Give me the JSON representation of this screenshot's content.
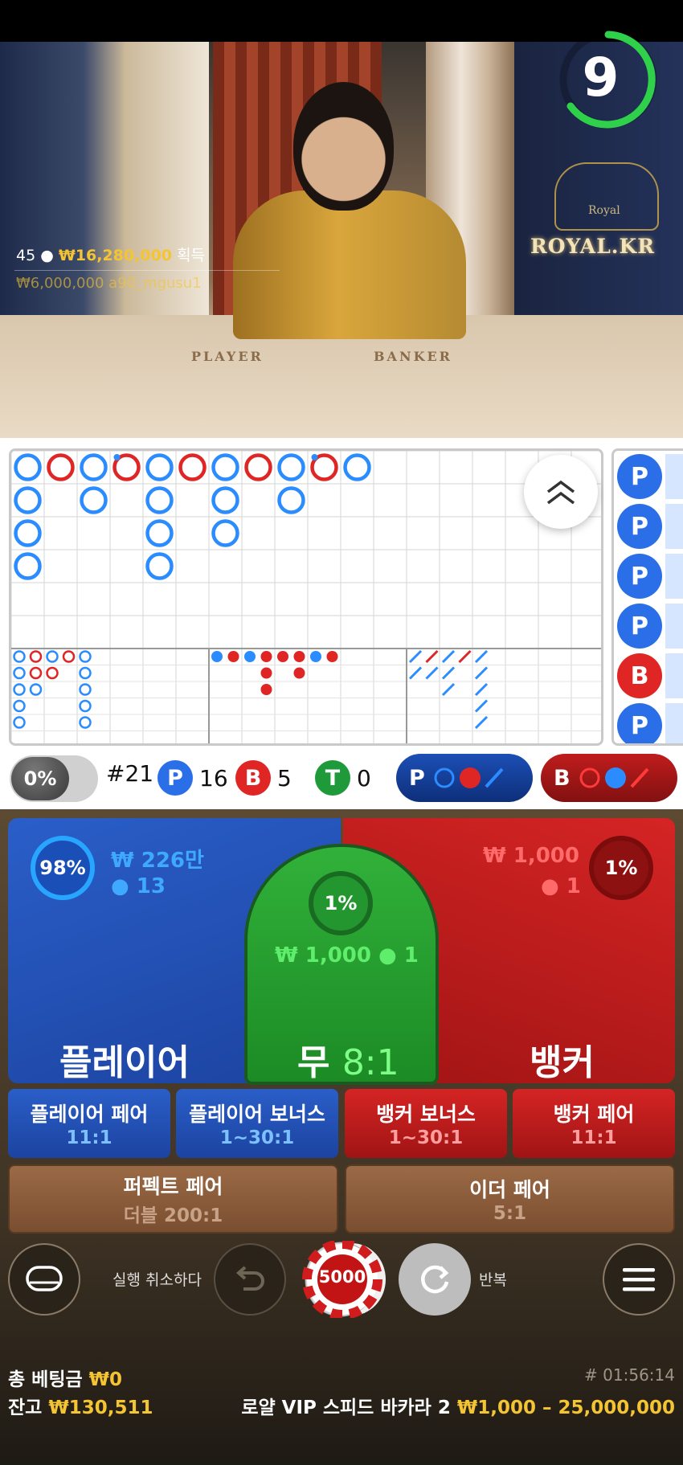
{
  "video": {
    "timer": "9",
    "logo_text": "ROYAL.KR",
    "crest_text": "Royal",
    "table_player": "PLAYER",
    "table_banker": "BANKER",
    "winners_count": "45",
    "winnings_amount": "₩16,280,000",
    "winnings_label": "획득",
    "last_win": "₩6,000,000  a90_mgusu1"
  },
  "stats": {
    "percent_toggle": "0%",
    "round": "#21",
    "player_letter": "P",
    "player_count": "16",
    "banker_letter": "B",
    "banker_count": "5",
    "tie_letter": "T",
    "tie_count": "0",
    "predict_player": "P",
    "predict_banker": "B"
  },
  "side_chips": [
    "P",
    "P",
    "P",
    "P",
    "B",
    "P"
  ],
  "bets": {
    "player": {
      "label": "플레이어",
      "percent": "98%",
      "amount": "₩ 226만",
      "users": "13"
    },
    "tie": {
      "label": "무",
      "odds": "8:1",
      "percent": "1%",
      "amount": "₩ 1,000",
      "users": "1"
    },
    "banker": {
      "label": "뱅커",
      "percent": "1%",
      "amount": "₩ 1,000",
      "users": "1"
    }
  },
  "side_bets": [
    {
      "title": "플레이어 페어",
      "odds": "11:1"
    },
    {
      "title": "플레이어 보너스",
      "odds": "1~30:1"
    },
    {
      "title": "뱅커 보너스",
      "odds": "1~30:1"
    },
    {
      "title": "뱅커 페어",
      "odds": "11:1"
    }
  ],
  "pair_bets": [
    {
      "title": "퍼펙트 페어",
      "odds": "더블 200:1"
    },
    {
      "title": "이더 페어",
      "odds": "5:1"
    }
  ],
  "controls": {
    "undo_label": "실행 취소하다",
    "chip_value": "5000",
    "repeat_label": "반복"
  },
  "footer": {
    "total_bet_label": "총 베팅금",
    "total_bet_value": "₩0",
    "balance_label": "잔고",
    "balance_value": "₩130,511",
    "round_id": "# 01:56:14",
    "table_name": "로얄 VIP 스피드 바카라 2",
    "limits": "₩1,000 – 25,000,000"
  },
  "colors": {
    "player_blue": "#2a6fe8",
    "banker_red": "#e02525",
    "tie_green": "#1f9a3a",
    "gold": "#f5c433"
  }
}
